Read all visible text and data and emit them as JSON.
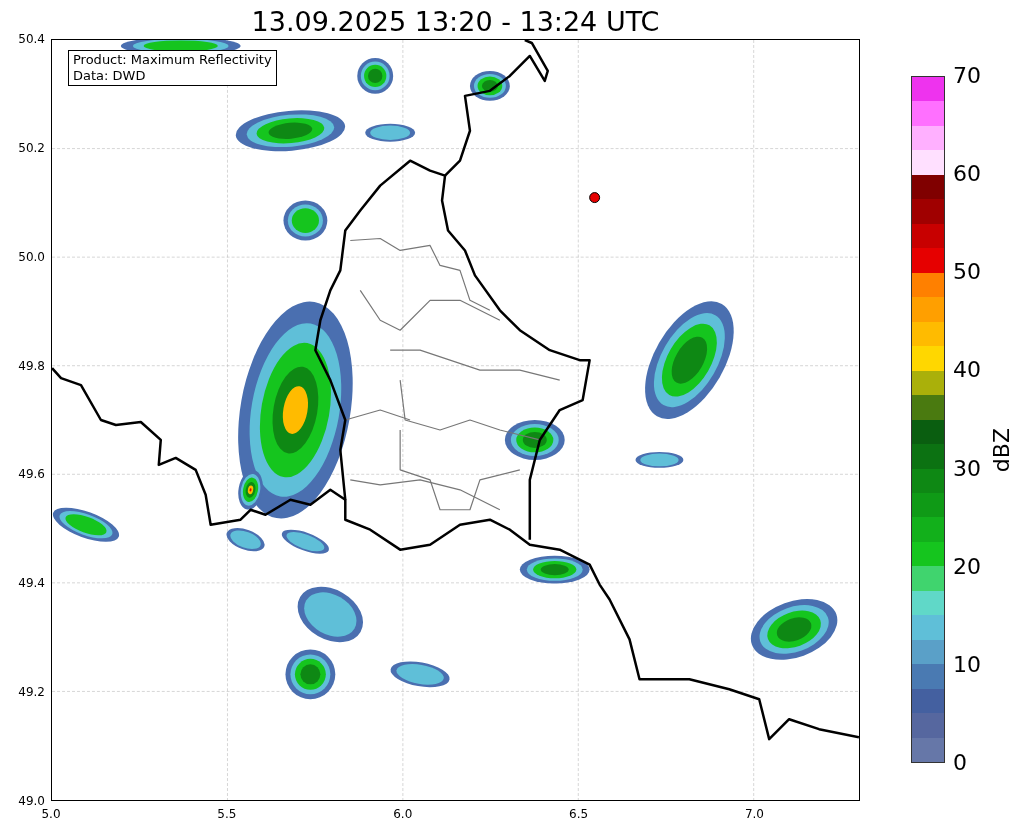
{
  "title": "13.09.2025 13:20 - 13:24 UTC",
  "map": {
    "legend": [
      "Product: Maximum Reflectivity",
      "Data: DWD"
    ],
    "xticks": [
      "5.0",
      "5.5",
      "6.0",
      "6.5",
      "7.0"
    ],
    "yticks": [
      "50.4",
      "50.2",
      "50.0",
      "49.8",
      "49.6",
      "49.4",
      "49.2",
      "49.0"
    ]
  },
  "colorbar": {
    "label": "dBZ",
    "ticks": [
      "70",
      "60",
      "50",
      "40",
      "30",
      "20",
      "10",
      "0"
    ],
    "segments": [
      {
        "color": "#ee33ee"
      },
      {
        "color": "#ff70ff"
      },
      {
        "color": "#ffb0ff"
      },
      {
        "color": "#ffe0ff"
      },
      {
        "color": "#800000"
      },
      {
        "color": "#a00000"
      },
      {
        "color": "#c80000"
      },
      {
        "color": "#e60000"
      },
      {
        "color": "#ff8000"
      },
      {
        "color": "#ff9f00"
      },
      {
        "color": "#ffbb00"
      },
      {
        "color": "#ffd700"
      },
      {
        "color": "#aab00a"
      },
      {
        "color": "#4a7a10"
      },
      {
        "color": "#0a5e10"
      },
      {
        "color": "#0c7212"
      },
      {
        "color": "#0e8814"
      },
      {
        "color": "#0f9a16"
      },
      {
        "color": "#12b01b"
      },
      {
        "color": "#15c51e"
      },
      {
        "color": "#40d46e"
      },
      {
        "color": "#60d8c8"
      },
      {
        "color": "#5fbfd8"
      },
      {
        "color": "#5aa0c8"
      },
      {
        "color": "#4a7ab2"
      },
      {
        "color": "#4460a0"
      },
      {
        "color": "#56679f"
      },
      {
        "color": "#6677a8"
      }
    ]
  }
}
